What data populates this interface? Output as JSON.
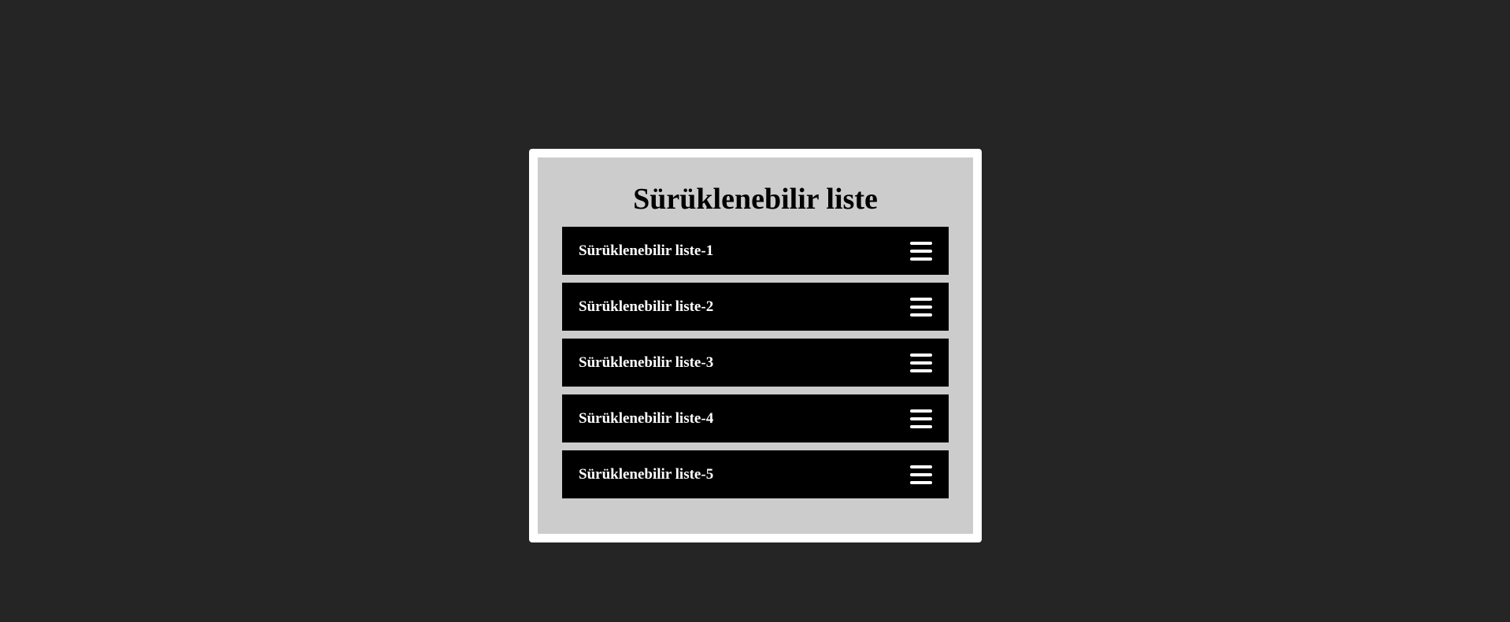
{
  "title": "Sürüklenebilir liste",
  "items": [
    {
      "label": "Sürüklenebilir liste-1",
      "icon": "hamburger-icon"
    },
    {
      "label": "Sürüklenebilir liste-2",
      "icon": "hamburger-icon"
    },
    {
      "label": "Sürüklenebilir liste-3",
      "icon": "hamburger-icon"
    },
    {
      "label": "Sürüklenebilir liste-4",
      "icon": "hamburger-icon"
    },
    {
      "label": "Sürüklenebilir liste-5",
      "icon": "hamburger-icon"
    }
  ],
  "colors": {
    "page_background": "#252525",
    "card_border": "#ffffff",
    "card_background": "#cccccc",
    "item_background": "#000000",
    "item_text": "#ffffff"
  }
}
